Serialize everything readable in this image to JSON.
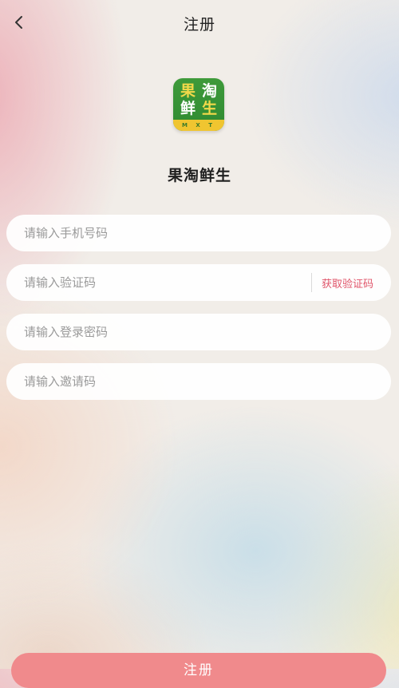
{
  "header": {
    "title": "注册"
  },
  "logo": {
    "chars": [
      "果",
      "淘",
      "鲜",
      "生"
    ],
    "band": "M X T"
  },
  "app_name": "果淘鲜生",
  "form": {
    "phone_placeholder": "请输入手机号码",
    "code_placeholder": "请输入验证码",
    "get_code_label": "获取验证码",
    "password_placeholder": "请输入登录密码",
    "invite_placeholder": "请输入邀请码"
  },
  "submit_label": "注册",
  "colors": {
    "accent": "#e0556a",
    "button": "#f08a8c",
    "logo_green": "#2f8a31",
    "logo_yellow": "#f2d94a"
  }
}
